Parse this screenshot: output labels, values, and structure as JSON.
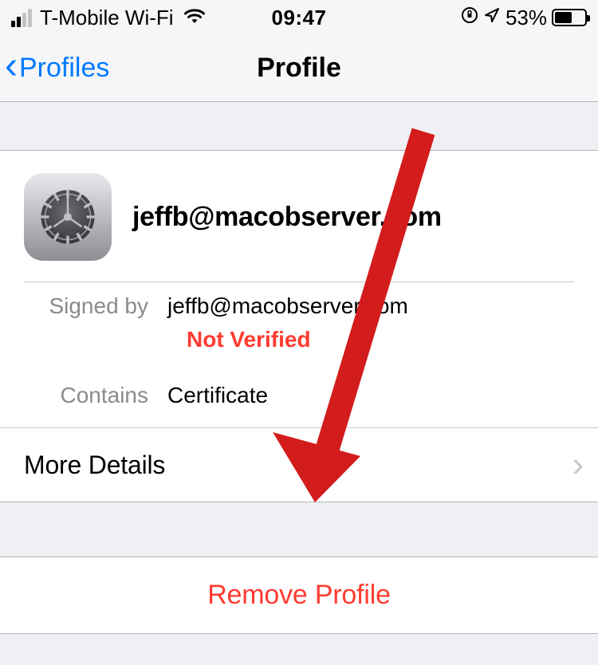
{
  "status_bar": {
    "carrier": "T-Mobile Wi-Fi",
    "time": "09:47",
    "battery_percent": "53%"
  },
  "nav": {
    "back_label": "Profiles",
    "title": "Profile"
  },
  "profile": {
    "email": "jeffb@macobserver.com",
    "signed_by_label": "Signed by",
    "signed_by_value": "jeffb@macobserver.com",
    "not_verified": "Not Verified",
    "contains_label": "Contains",
    "contains_value": "Certificate",
    "more_details": "More Details",
    "remove_label": "Remove Profile"
  }
}
